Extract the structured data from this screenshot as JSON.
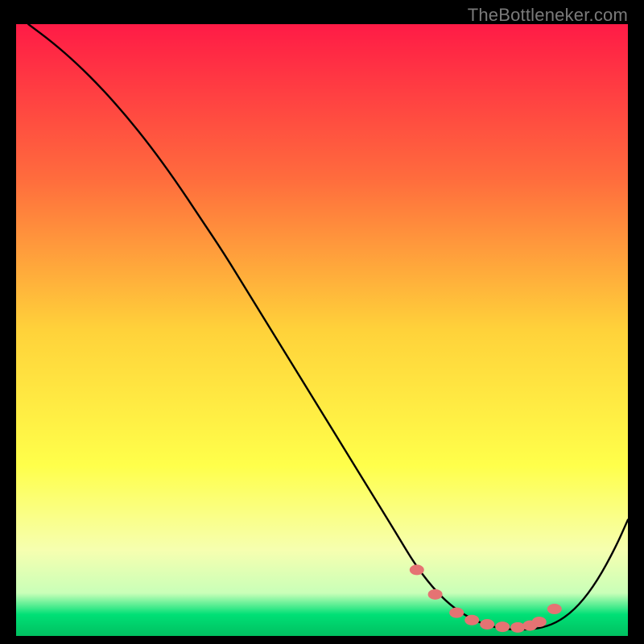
{
  "watermark": "TheBottleneker.com",
  "chart_data": {
    "type": "line",
    "title": "",
    "xlabel": "",
    "ylabel": "",
    "xlim": [
      0,
      100
    ],
    "ylim": [
      0,
      100
    ],
    "grid": false,
    "legend": false,
    "gradient_stops": [
      {
        "offset": 0.0,
        "color": "#ff1b46"
      },
      {
        "offset": 0.25,
        "color": "#ff6b3d"
      },
      {
        "offset": 0.5,
        "color": "#ffd23a"
      },
      {
        "offset": 0.72,
        "color": "#ffff4a"
      },
      {
        "offset": 0.86,
        "color": "#f6ffb0"
      },
      {
        "offset": 0.93,
        "color": "#c9ffb8"
      },
      {
        "offset": 0.965,
        "color": "#00e076"
      },
      {
        "offset": 1.0,
        "color": "#00c060"
      }
    ],
    "series": [
      {
        "name": "curve",
        "x": [
          2,
          6,
          10,
          14,
          18,
          22,
          26,
          30,
          34,
          38,
          42,
          46,
          50,
          54,
          58,
          62,
          65,
          68,
          71,
          74,
          77,
          80,
          83,
          86,
          89,
          92,
          95,
          98,
          100
        ],
        "y": [
          100,
          97,
          93.5,
          89.5,
          85,
          80,
          74.5,
          68.5,
          62.5,
          56,
          49.5,
          43,
          36.5,
          30,
          23.5,
          17,
          12,
          8,
          5,
          3,
          1.7,
          1.1,
          1.0,
          1.3,
          2.5,
          5.0,
          9.0,
          14.5,
          19
        ]
      }
    ],
    "markers": {
      "name": "highlight-points",
      "color": "#e57373",
      "x": [
        65.5,
        68.5,
        72,
        74.5,
        77,
        79.5,
        82,
        84,
        85.5,
        88
      ],
      "y": [
        10.8,
        6.8,
        3.8,
        2.6,
        1.9,
        1.5,
        1.4,
        1.7,
        2.3,
        4.4
      ]
    }
  }
}
